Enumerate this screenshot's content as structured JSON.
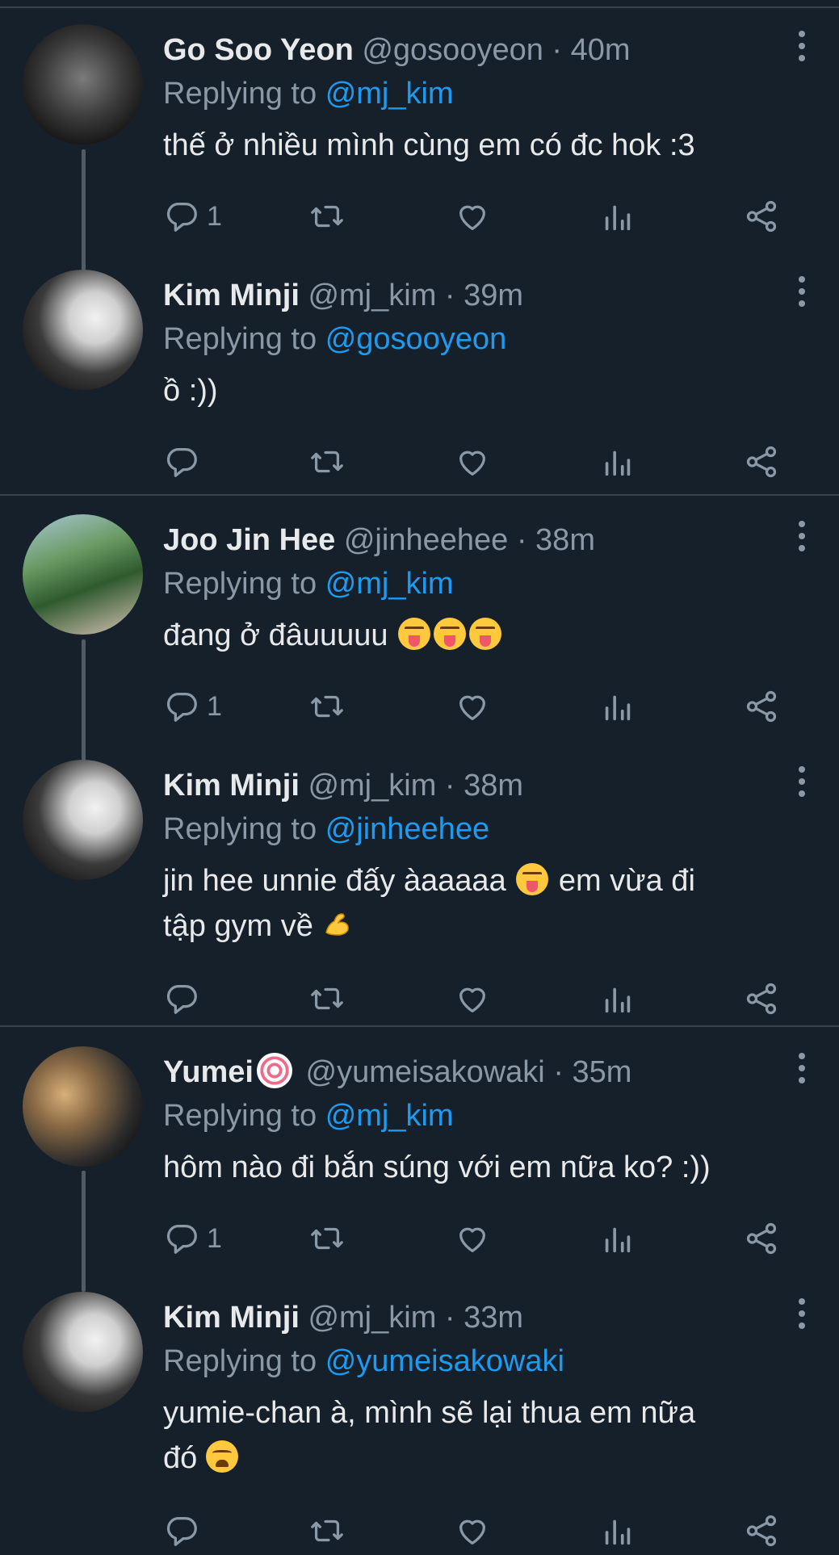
{
  "colors": {
    "background": "#15202b",
    "text": "#e7e9ea",
    "muted": "#8b98a5",
    "link": "#1d9bf0",
    "divider": "#38444d"
  },
  "labels": {
    "replying_to": "Replying to",
    "separator": "·"
  },
  "tweets": [
    {
      "name": "Go Soo Yeon",
      "handle": "@gosooyeon",
      "time": "40m",
      "reply_to": "@mj_kim",
      "text": "thế ở nhiều mình cùng em có đc hok :3",
      "reply_count": "1"
    },
    {
      "name": "Kim Minji",
      "handle": "@mj_kim",
      "time": "39m",
      "reply_to": "@gosooyeon",
      "text": "ồ :))",
      "reply_count": ""
    },
    {
      "name": "Joo Jin Hee",
      "handle": "@jinheehee",
      "time": "38m",
      "reply_to": "@mj_kim",
      "text": "đang ở đâuuuuu",
      "emoji": [
        "squinting-face-with-tongue",
        "squinting-face-with-tongue",
        "squinting-face-with-tongue"
      ],
      "reply_count": "1"
    },
    {
      "name": "Kim Minji",
      "handle": "@mj_kim",
      "time": "38m",
      "reply_to": "@jinheehee",
      "text_line1_a": "jin hee unnie đấy àaaaaa",
      "text_line1_b": "em vừa đi",
      "text_line2": "tập gym về",
      "emoji": [
        "squinting-face-with-tongue",
        "flexed-biceps"
      ],
      "reply_count": ""
    },
    {
      "name": "Yumei",
      "badge": "fish-cake-badge",
      "handle": "@yumeisakowaki",
      "time": "35m",
      "reply_to": "@mj_kim",
      "text": "hôm nào đi bắn súng với em nữa ko? :))",
      "reply_count": "1"
    },
    {
      "name": "Kim Minji",
      "handle": "@mj_kim",
      "time": "33m",
      "reply_to": "@yumeisakowaki",
      "text_line1": "yumie-chan à, mình sẽ lại thua em nữa",
      "text_line2": "đó",
      "emoji": [
        "tired-face"
      ],
      "reply_count": ""
    }
  ]
}
